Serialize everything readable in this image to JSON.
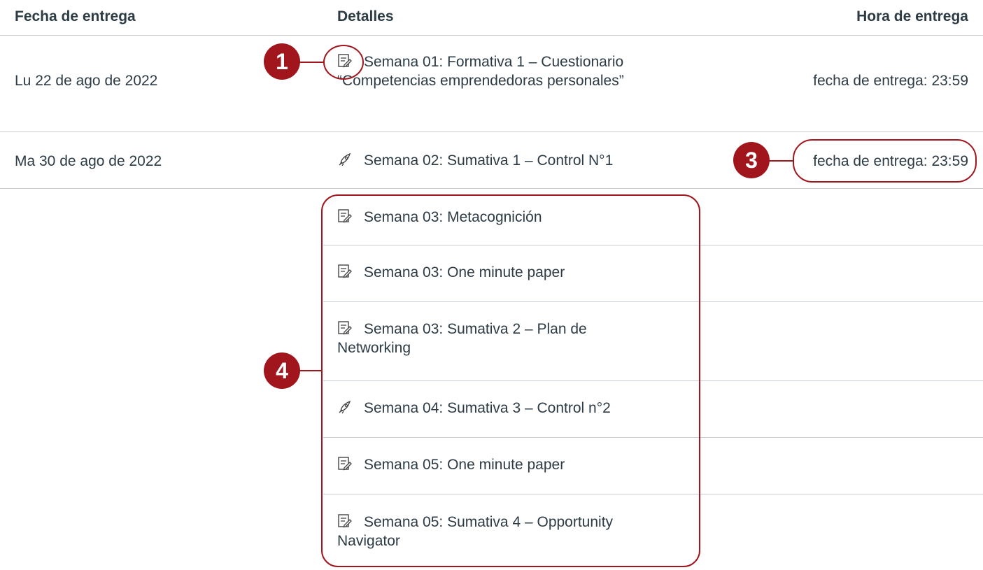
{
  "table": {
    "headers": {
      "date": "Fecha de entrega",
      "details": "Detalles",
      "time": "Hora de entrega"
    },
    "rows": [
      {
        "date": "Lu 22 de ago de 2022",
        "time": "fecha de entrega: 23:59",
        "items": [
          {
            "icon": "assignment-icon",
            "title": "Semana 01: Formativa 1 – Cuestionario “Competencias emprendedoras personales”"
          }
        ]
      },
      {
        "date": "Ma 30 de ago de 2022",
        "time": "fecha de entrega: 23:59",
        "items": [
          {
            "icon": "quiz-rocket-icon",
            "title": "Semana 02: Sumativa 1 – Control N°1"
          }
        ]
      },
      {
        "date": "",
        "time": "",
        "items": [
          {
            "icon": "assignment-icon",
            "title": "Semana 03: Metacognición"
          },
          {
            "icon": "assignment-icon",
            "title": "Semana 03: One minute paper"
          },
          {
            "icon": "assignment-icon",
            "title": "Semana 03: Sumativa 2 – Plan de Networking"
          },
          {
            "icon": "quiz-rocket-icon",
            "title": "Semana 04: Sumativa 3 – Control n°2"
          },
          {
            "icon": "assignment-icon",
            "title": "Semana 05: One minute paper"
          },
          {
            "icon": "assignment-icon",
            "title": "Semana 05: Sumativa 4 – Opportunity Navigator"
          }
        ]
      }
    ]
  },
  "callouts": [
    {
      "label": "1"
    },
    {
      "label": "3"
    },
    {
      "label": "4"
    }
  ],
  "colors": {
    "accent": "#a0161c",
    "text": "#2d3b45",
    "divider": "#c7cdd1"
  }
}
